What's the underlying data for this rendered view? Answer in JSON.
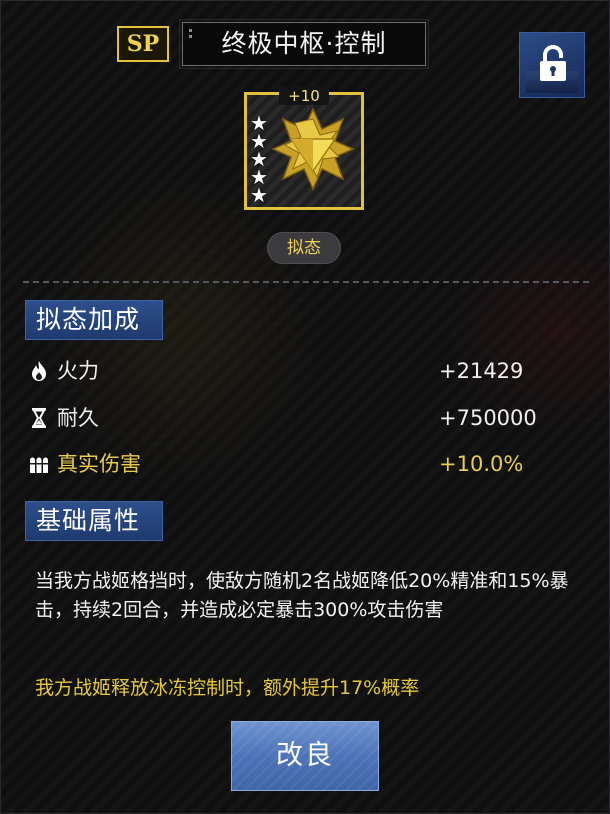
{
  "header": {
    "sp_badge": "SP",
    "title": "终极中枢·控制",
    "lock_icon": "lock-icon"
  },
  "item": {
    "level": "+10",
    "stars": 5,
    "state": "拟态"
  },
  "bonus_section": {
    "title": "拟态加成",
    "stats": [
      {
        "icon": "flame-icon",
        "label": "火力",
        "value": "+21429",
        "highlight": false
      },
      {
        "icon": "hourglass-icon",
        "label": "耐久",
        "value": "+750000",
        "highlight": false
      },
      {
        "icon": "bullets-icon",
        "label": "真实伤害",
        "value": "+10.0%",
        "highlight": true
      }
    ]
  },
  "base_section": {
    "title": "基础属性",
    "description": "当我方战姬格挡时，使敌方随机2名战姬降低20%精准和15%暴击，持续2回合，并造成必定暴击300%攻击伤害",
    "extra": "我方战姬释放冰冻控制时，额外提升17%概率"
  },
  "actions": {
    "upgrade_label": "改良"
  },
  "colors": {
    "gold": "#e9cd4c",
    "section_blue": "#2d4f8c",
    "button_blue": "#5a80c2"
  }
}
